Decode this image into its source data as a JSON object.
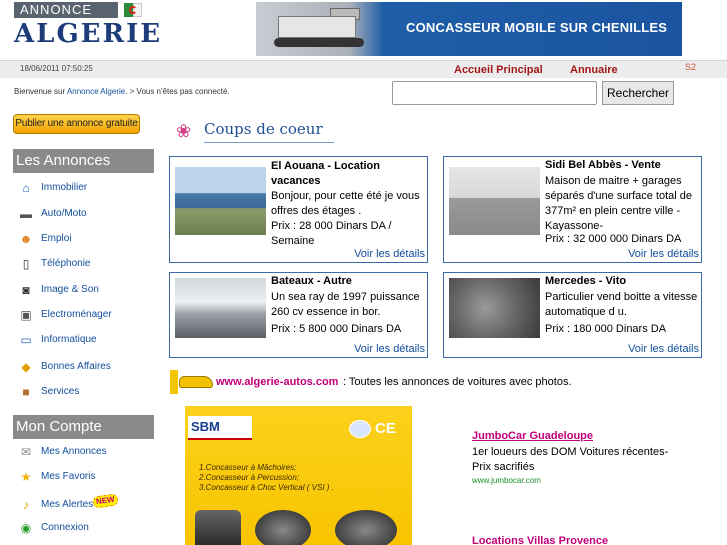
{
  "header": {
    "logo_top": "ANNONCE",
    "logo_bottom": "ALGERIE",
    "banner_text": "CONCASSEUR MOBILE SUR CHENILLES"
  },
  "topbar": {
    "datetime": "18/06/2011 07:50:25",
    "nav_home": "Accueil Principal",
    "nav_directory": "Annuaire",
    "badge": "S2"
  },
  "welcome": {
    "prefix": "Bienvenue sur ",
    "site": "Annonce Algerie",
    "suffix": ". > Vous n'êtes pas connecté."
  },
  "search": {
    "value": "",
    "button": "Rechercher"
  },
  "sidebar": {
    "publish_button": "Publier une annonce gratuite",
    "annonces_heading": "Les Annonces",
    "annonces": [
      {
        "label": "Immobilier",
        "icon": "house-icon"
      },
      {
        "label": "Auto/Moto",
        "icon": "car-icon"
      },
      {
        "label": "Emploi",
        "icon": "person-icon"
      },
      {
        "label": "Téléphonie",
        "icon": "phone-icon"
      },
      {
        "label": "Image & Son",
        "icon": "camera-icon"
      },
      {
        "label": "Electroménager",
        "icon": "appliance-icon"
      },
      {
        "label": "Informatique",
        "icon": "computer-icon"
      },
      {
        "label": "Bonnes Affaires",
        "icon": "tag-icon"
      },
      {
        "label": "Services",
        "icon": "box-icon"
      }
    ],
    "compte_heading": "Mon Compte",
    "compte": [
      {
        "label": "Mes Annonces",
        "icon": "envelope-icon"
      },
      {
        "label": "Mes Favoris",
        "icon": "star-icon"
      },
      {
        "label": "Mes Alertes",
        "icon": "bell-icon"
      },
      {
        "label": "Connexion",
        "icon": "login-icon"
      }
    ],
    "new_badge": "NEW"
  },
  "main": {
    "section_title": "Coups de coeur",
    "cards": [
      {
        "title": "El Aouana - Location vacances",
        "description": "Bonjour, pour cette été je vous offres des étages .",
        "price": "Prix : 28 000 Dinars DA / Semaine",
        "link": "Voir les détails"
      },
      {
        "title": "Sidi Bel Abbès - Vente",
        "description": "Maison de maitre + garages séparés d'une surface total de 377m² en plein centre ville - Kayassone-",
        "price": "Prix : 32 000 000 Dinars DA",
        "link": "Voir les détails"
      },
      {
        "title": "Bateaux - Autre",
        "description": "Un sea ray de 1997 puissance 260 cv essence in bor.",
        "price": "Prix : 5 800 000 Dinars DA",
        "link": "Voir les détails"
      },
      {
        "title": "Mercedes - Vito",
        "description": "Particulier vend boitte a vitesse automatique d u.",
        "price": "Prix : 180 000 Dinars DA",
        "link": "Voir les détails"
      }
    ],
    "promo_link": "www.algerie-autos.com",
    "promo_text": ": Toutes les annonces de voitures avec photos."
  },
  "ads": {
    "sbm_logo": "SBM",
    "sbm_ce": "CE",
    "sbm_lines": [
      "1.Concasseur à Mâchoires;",
      "2.Concasseur à Percussion;",
      "3.Concasseur à Choc Vertical ( VSI ) ."
    ],
    "jumbo_title": "JumboCar Guadeloupe",
    "jumbo_line1": "1er loueurs des DOM Voitures récentes-",
    "jumbo_line2": "Prix sacrifiés",
    "jumbo_url": "www.jumbocar.com",
    "villas_title": "Locations Villas Provence"
  }
}
